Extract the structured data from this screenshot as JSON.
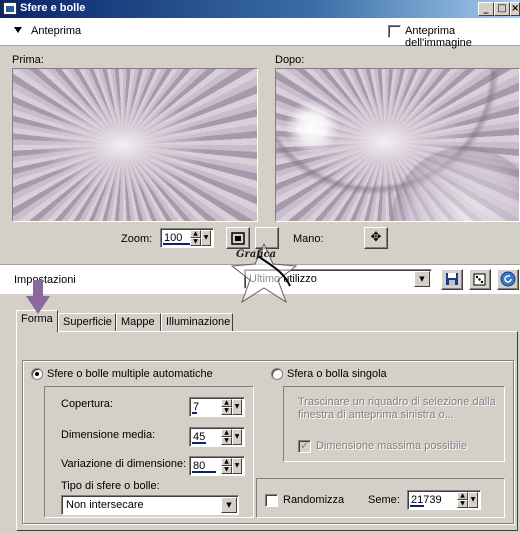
{
  "window": {
    "title": "Sfere e bolle",
    "min_glyph": "_",
    "max_glyph": "□",
    "close_glyph": "×"
  },
  "preview_bar": {
    "toggle_label": "Anteprima",
    "preview_image_label": "Anteprima dell'immagine",
    "preview_image_checked": false
  },
  "previews": {
    "before_label": "Prima:",
    "after_label": "Dopo:"
  },
  "zoom_bar": {
    "zoom_label": "Zoom:",
    "zoom_value": "100",
    "hand_label": "Mano:",
    "hand_icon_glyph": "✥"
  },
  "settings": {
    "label": "Impostazioni",
    "preset_value": "Ultimo utilizzo"
  },
  "watermark": {
    "text": "Grafica"
  },
  "tabs": [
    {
      "label": "Forma",
      "active": true
    },
    {
      "label": "Superficie",
      "active": false
    },
    {
      "label": "Mappe",
      "active": false
    },
    {
      "label": "Illuminazione",
      "active": false
    }
  ],
  "forma": {
    "multi_option": "Sfere o bolle multiple automatiche",
    "multi_selected": true,
    "copertura_label": "Copertura:",
    "copertura_value": "7",
    "dimensione_media_label": "Dimensione media:",
    "dimensione_media_value": "45",
    "variazione_label": "Variazione di dimensione:",
    "variazione_value": "80",
    "tipo_label": "Tipo di sfere o bolle:",
    "tipo_value": "Non intersecare",
    "single_option": "Sfera o bolla singola",
    "single_selected": false,
    "single_hint": "Trascinare un riquadro di selezione dalla finestra di anteprima sinistra o...",
    "max_size_label": "Dimensione massima possibile",
    "max_size_checked": true,
    "randomizza_label": "Randomizza",
    "randomizza_checked": false,
    "seme_label": "Seme:",
    "seme_value": "21739"
  }
}
